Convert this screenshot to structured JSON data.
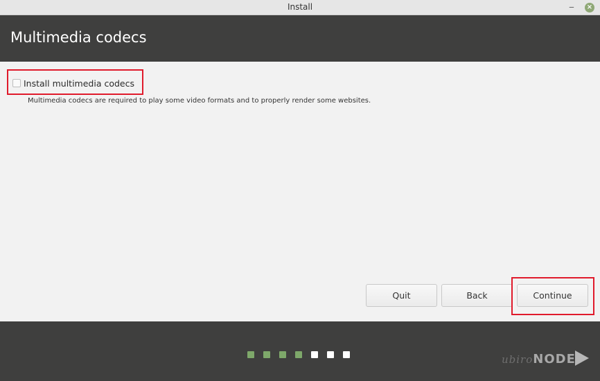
{
  "window": {
    "title": "Install"
  },
  "header": {
    "title": "Multimedia codecs"
  },
  "codecs": {
    "checkbox_label": "Install multimedia codecs",
    "checked": false,
    "description": "Multimedia codecs are required to play some video formats and to properly render some websites."
  },
  "buttons": {
    "quit": "Quit",
    "back": "Back",
    "continue": "Continue"
  },
  "progress": {
    "steps": [
      {
        "completed": true
      },
      {
        "completed": true
      },
      {
        "completed": true
      },
      {
        "completed": true
      },
      {
        "completed": false
      },
      {
        "completed": false
      },
      {
        "completed": false
      }
    ],
    "completed_color": "#7ea86a",
    "pending_color": "#ffffff"
  },
  "watermark": {
    "part1": "ubiro",
    "part2": "NODE"
  },
  "colors": {
    "highlight": "#e01a2b",
    "header_bg": "#3f3f3e",
    "accent": "#8fa876"
  }
}
